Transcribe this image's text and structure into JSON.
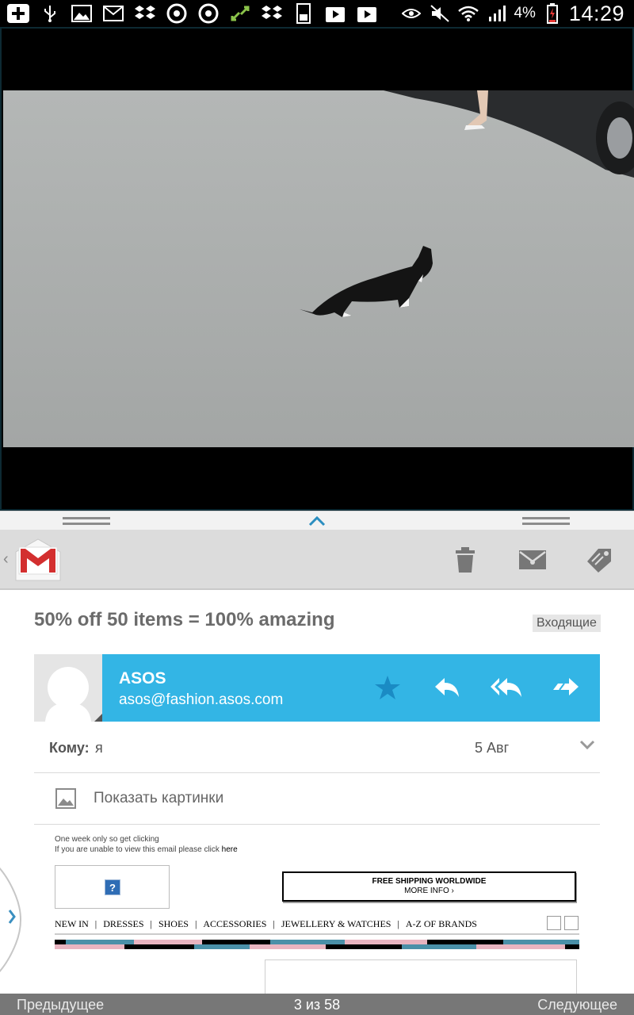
{
  "status_bar": {
    "time": "14:29",
    "battery_percent": "4%",
    "notification_icons": [
      "add-icon",
      "usb-icon",
      "gallery-icon",
      "gmail-icon",
      "dropbox-icon",
      "chrome-icon",
      "chrome-icon",
      "sync-icon",
      "dropbox-icon",
      "download-icon",
      "play-store-icon",
      "play-store-icon"
    ],
    "system_icons": [
      "eye-icon",
      "mute-icon",
      "wifi-icon",
      "signal-icon",
      "battery-charging-icon"
    ]
  },
  "video": {
    "description_icon": "video-frame"
  },
  "toolbar": {
    "app": "gmail-logo-icon",
    "actions": [
      "trash-icon",
      "mark-unread-icon",
      "label-icon"
    ]
  },
  "email": {
    "subject": "50% off 50 items = 100% amazing",
    "folder_label": "Входящие",
    "sender_name": "ASOS",
    "sender_email": "asos@fashion.asos.com",
    "to_label": "Кому:",
    "to_value": "я",
    "date": "5 Авг",
    "show_pictures": "Показать картинки",
    "body": {
      "line1": "One week only so get clicking",
      "line2_prefix": "If you are unable to view this email please click",
      "line2_link": "here",
      "broken_image_glyph": "?",
      "shipping_main": "FREE SHIPPING WORLDWIDE",
      "shipping_sub": "MORE INFO  ›",
      "nav": [
        "NEW IN",
        "DRESSES",
        "SHOES",
        "ACCESSORIES",
        "JEWELLERY & WATCHES",
        "A-Z OF BRANDS"
      ],
      "nav_separator": "|"
    }
  },
  "bottom_bar": {
    "prev": "Предыдущее",
    "position": "3 из 58",
    "next": "Следующее"
  },
  "colors": {
    "sender_bar": "#33b5e5",
    "toolbar": "#dcdcdc",
    "bottom_bar": "#777777"
  }
}
